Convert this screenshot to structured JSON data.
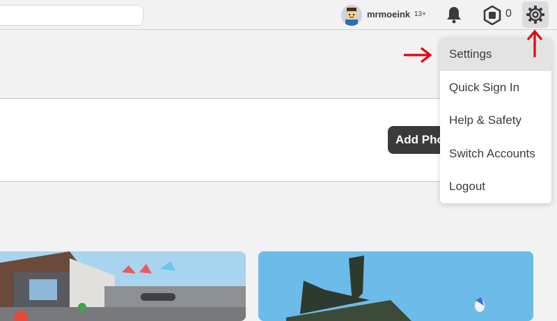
{
  "header": {
    "username": "mrmoeink",
    "age_badge": "13+",
    "robux_count": "0",
    "icons": {
      "avatar": "avatar-icon",
      "notifications": "bell-icon",
      "robux": "robux-icon",
      "settings": "gear-icon"
    }
  },
  "profile": {
    "add_photo_label": "Add Pho"
  },
  "settings_menu": {
    "items": [
      {
        "label": "Settings"
      },
      {
        "label": "Quick Sign In"
      },
      {
        "label": "Help & Safety"
      },
      {
        "label": "Switch Accounts"
      },
      {
        "label": "Logout"
      }
    ]
  },
  "annotations": {
    "arrow_color": "#e8000b"
  },
  "colors": {
    "page_bg": "#f2f2f3",
    "text": "#393b3d",
    "button_dark": "#393b3d"
  }
}
